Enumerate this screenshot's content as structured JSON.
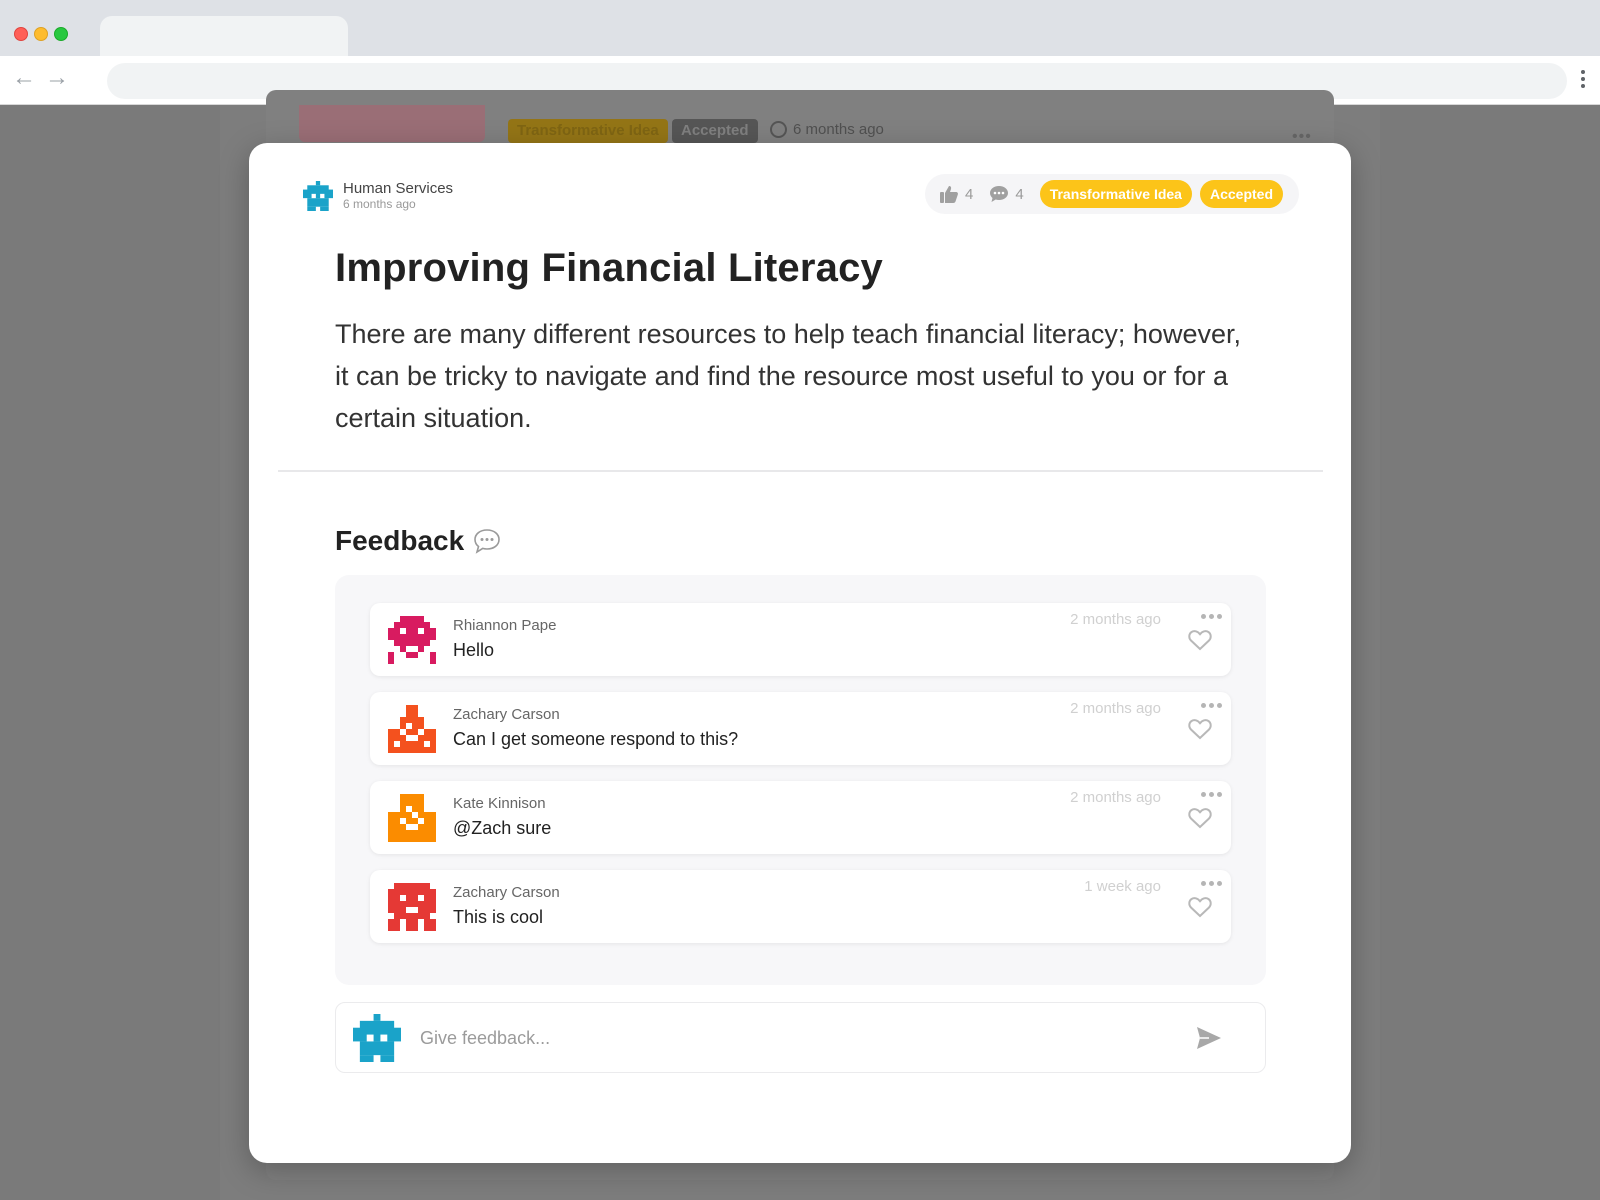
{
  "background_page": {
    "tags": [
      "Transformative Idea",
      "Accepted"
    ],
    "time": "6 months ago"
  },
  "idea": {
    "org_name": "Human Services",
    "org_time": "6 months ago",
    "likes": "4",
    "comments": "4",
    "tags": [
      "Transformative Idea",
      "Accepted"
    ],
    "title": "Improving Financial Literacy",
    "description": "There are many different resources to help teach financial literacy; however, it can be tricky to navigate and find the resource most useful to you or for a certain situation.",
    "accent_color": "#fcc419",
    "org_avatar_color": "#1aa3c9"
  },
  "feedback": {
    "heading": "Feedback",
    "comments": [
      {
        "author": "Rhiannon Pape",
        "text": "Hello",
        "time": "2 months ago",
        "avatar_color": "#d81b60"
      },
      {
        "author": "Zachary Carson",
        "text": "Can I get someone respond to this?",
        "time": "2 months ago",
        "avatar_color": "#f4511e"
      },
      {
        "author": "Kate Kinnison",
        "text": "@Zach sure",
        "time": "2 months ago",
        "avatar_color": "#fb8c00"
      },
      {
        "author": "Zachary Carson",
        "text": "This is cool",
        "time": "1 week ago",
        "avatar_color": "#e53935"
      }
    ],
    "input_placeholder": "Give feedback..."
  }
}
